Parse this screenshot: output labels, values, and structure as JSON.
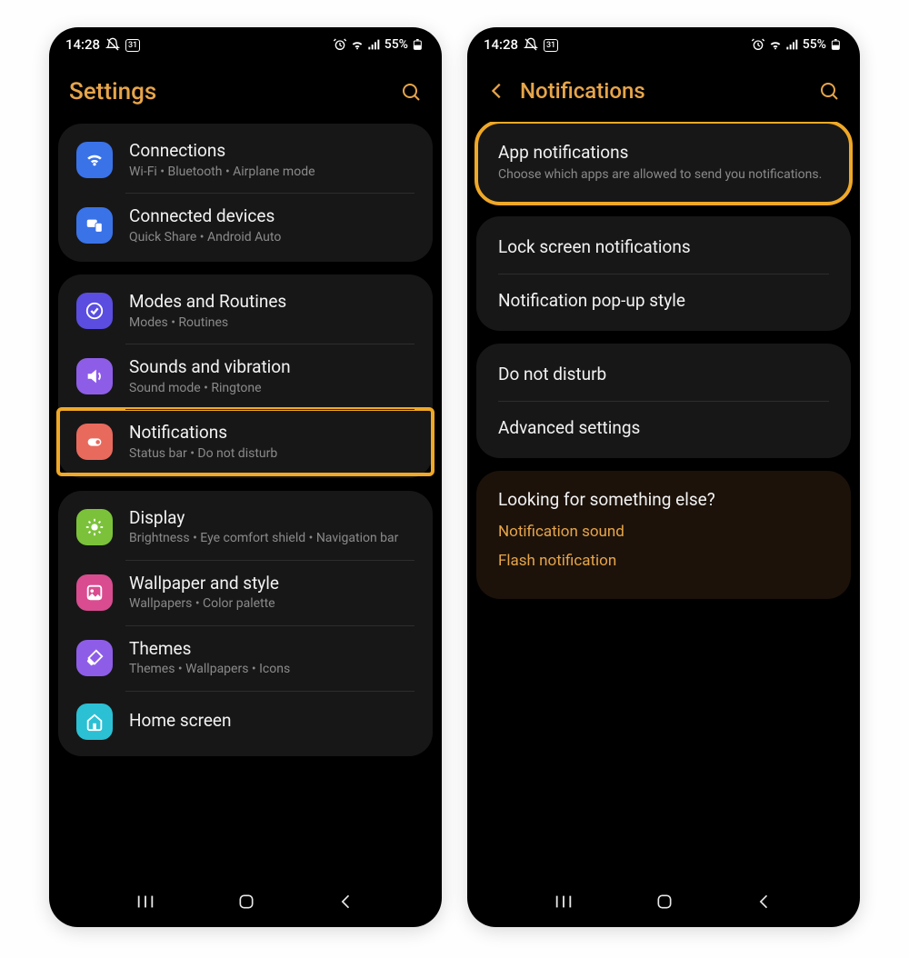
{
  "status": {
    "time": "14:28",
    "cal": "31",
    "battery": "55%"
  },
  "left": {
    "title": "Settings",
    "groups": [
      {
        "rows": [
          {
            "icon": "wifi",
            "color": "#3a73e8",
            "label": "Connections",
            "sub": "Wi-Fi  •  Bluetooth  •  Airplane mode"
          },
          {
            "icon": "devices",
            "color": "#3a73e8",
            "label": "Connected devices",
            "sub": "Quick Share  •  Android Auto"
          }
        ]
      },
      {
        "rows": [
          {
            "icon": "check",
            "color": "#5a4de0",
            "label": "Modes and Routines",
            "sub": "Modes  •  Routines"
          },
          {
            "icon": "sound",
            "color": "#8e5de8",
            "label": "Sounds and vibration",
            "sub": "Sound mode  •  Ringtone"
          },
          {
            "icon": "bell",
            "color": "#e86a5d",
            "label": "Notifications",
            "sub": "Status bar  •  Do not disturb",
            "hl": true
          }
        ]
      },
      {
        "rows": [
          {
            "icon": "sun",
            "color": "#7bc23a",
            "label": "Display",
            "sub": "Brightness  •  Eye comfort shield  •  Navigation bar"
          },
          {
            "icon": "image",
            "color": "#d94c8f",
            "label": "Wallpaper and style",
            "sub": "Wallpapers  •  Color palette"
          },
          {
            "icon": "brush",
            "color": "#8e5de8",
            "label": "Themes",
            "sub": "Themes  •  Wallpapers  •  Icons"
          },
          {
            "icon": "home",
            "color": "#2cc0d4",
            "label": "Home screen",
            "sub": ""
          }
        ]
      }
    ]
  },
  "right": {
    "title": "Notifications",
    "groups": [
      {
        "hl": true,
        "rows": [
          {
            "label": "App notifications",
            "sub": "Choose which apps are allowed to send you notifications."
          }
        ]
      },
      {
        "rows": [
          {
            "label": "Lock screen notifications"
          },
          {
            "label": "Notification pop-up style"
          }
        ]
      },
      {
        "rows": [
          {
            "label": "Do not disturb"
          },
          {
            "label": "Advanced settings"
          }
        ]
      }
    ],
    "lookfor": {
      "heading": "Looking for something else?",
      "links": [
        "Notification sound",
        "Flash notification"
      ]
    }
  }
}
